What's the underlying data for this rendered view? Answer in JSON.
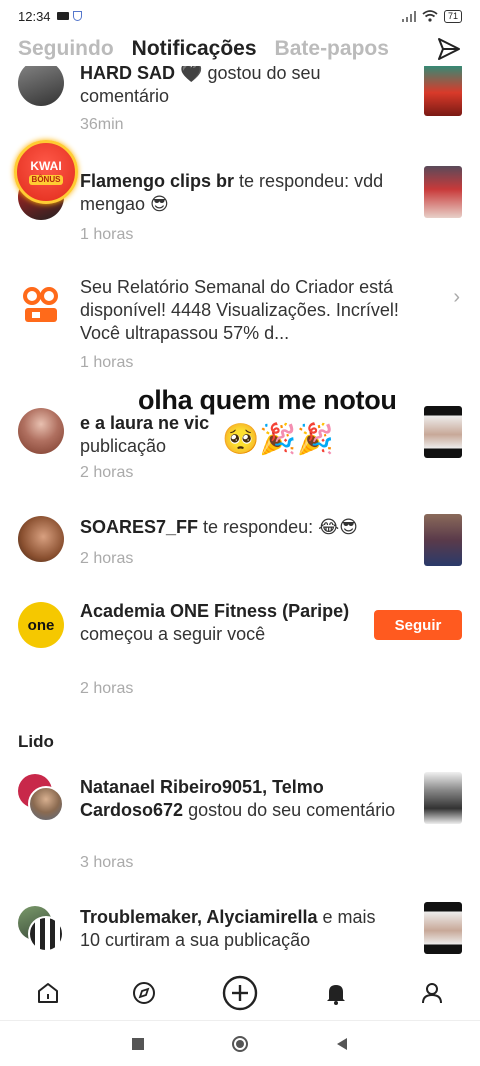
{
  "status_bar": {
    "time": "12:34",
    "battery": "71"
  },
  "tabs": [
    {
      "label": "Seguindo"
    },
    {
      "label": "Notificações"
    },
    {
      "label": "Bate-papos"
    }
  ],
  "kwai_badge": {
    "line1": "KWAI",
    "line2": "BÔNUS"
  },
  "notifications": [
    {
      "text": "gostou do seu comentário",
      "user": "HARD SAD 🖤",
      "time": "36min"
    },
    {
      "text": "te respondeu: vdd mengao 😎",
      "user": "Flamengo clips br",
      "time": "1 horas"
    },
    {
      "text": "Seu Relatório Semanal do Criador está disponível! 4448 Visualizações. Incrível! Você ultrapassou 57% d...",
      "time": "1 horas"
    },
    {
      "text": "publicação",
      "user": "e a laura ne vic",
      "time": "2 horas"
    },
    {
      "text": "te respondeu: 😂😎",
      "user": "SOARES7_FF",
      "time": "2 horas"
    },
    {
      "text": "começou a seguir você",
      "user": "Academia ONE Fitness (Paripe)",
      "time": "2 horas",
      "button": "Seguir"
    }
  ],
  "read_section": {
    "label": "Lido",
    "items": [
      {
        "users": "Natanael Ribeiro9051, Telmo Cardoso672",
        "text": "gostou do seu comentário",
        "time": "3 horas"
      },
      {
        "users": "Troublemaker, Alyciamirella",
        "text": "e mais 10 curtiram a sua publicação"
      }
    ]
  },
  "overlay": {
    "caption": "olha quem me notou",
    "emojis": "🥺🎉🎉"
  },
  "colors": {
    "accent": "#ff5a1f",
    "muted": "#aaaaaa"
  }
}
